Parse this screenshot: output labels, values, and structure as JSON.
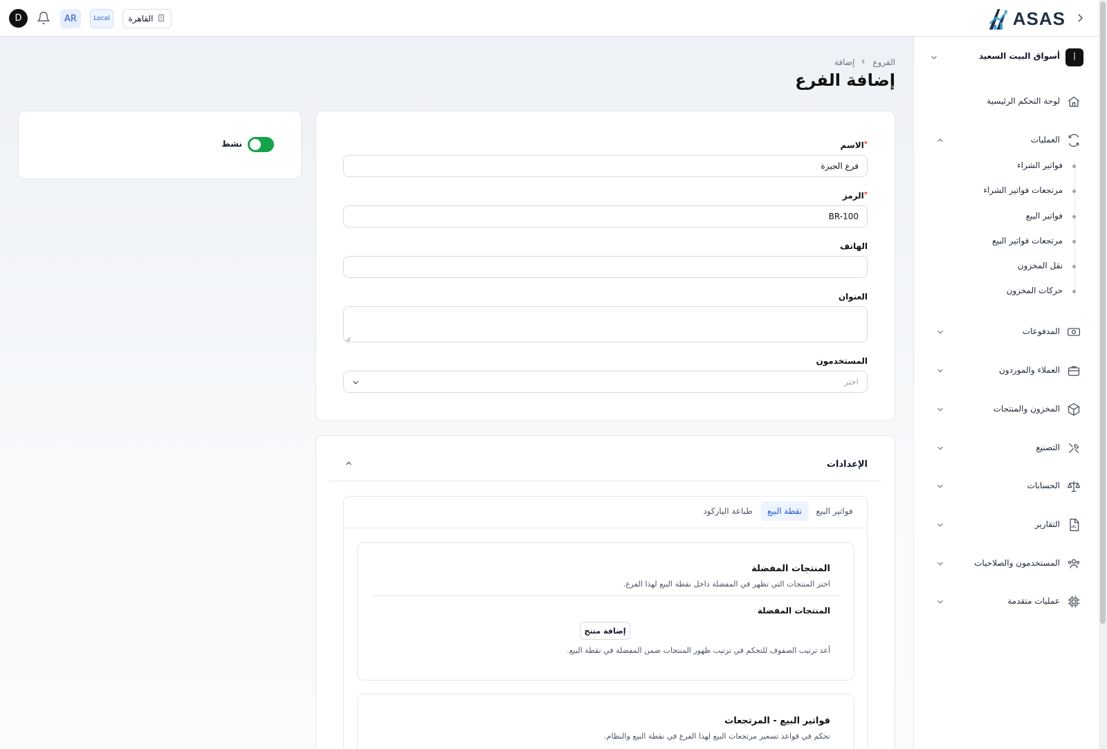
{
  "topbar": {
    "user_initial": "D",
    "language": "AR",
    "env_badge": "Local",
    "branch": "القاهرة",
    "logo_text": "ASAS"
  },
  "sidebar": {
    "org": {
      "badge": "أ",
      "name": "أسواق البيت السعيد"
    },
    "dashboard": "لوحة التحكم الرئيسية",
    "operations": {
      "label": "العمليات",
      "items": [
        "فواتير الشراء",
        "مرتجعات فواتير الشراء",
        "فواتير البيع",
        "مرتجعات فواتير البيع",
        "نقل المخزون",
        "حركات المخزون"
      ]
    },
    "sections": [
      "المدفوعات",
      "العملاء والموردون",
      "المخزون والمنتجات",
      "التصنيع",
      "الحسابات",
      "التقارير",
      "المستخدمون والصلاحيات",
      "عمليات متقدمة"
    ]
  },
  "breadcrumb": {
    "parent": "الفروع",
    "current": "إضافة"
  },
  "page_title": "إضافة الفرع",
  "form": {
    "name_label": "الاسم",
    "name_value": "فرع الجيزة",
    "code_label": "الرمز",
    "code_value": "BR-100",
    "phone_label": "الهاتف",
    "phone_value": "",
    "address_label": "العنوان",
    "users_label": "المستخدمون",
    "users_placeholder": "اختر",
    "required_mark": "*"
  },
  "status": {
    "active_label": "نشط",
    "active": true
  },
  "settings": {
    "title": "الإعدادات",
    "tabs": [
      "فواتير البيع",
      "نقطة البيع",
      "طباعة الباركود"
    ],
    "active_tab": "نقطة البيع",
    "favorites": {
      "title": "المنتجات المفضلة",
      "desc": "اختر المنتجات التي تظهر في المفضلة داخل نقطة البيع لهذا الفرع.",
      "subtitle": "المنتجات المفضلة",
      "add_button": "إضافة منتج",
      "hint": "أعد ترتيب الصفوف للتحكم في ترتيب ظهور المنتجات ضمن المفضلة في نقطة البيع."
    },
    "returns": {
      "title": "فواتير البيع - المرتجعات",
      "desc": "تحكم في قواعد تسعير مرتجعات البيع لهذا الفرع في نقطة البيع والنظام."
    }
  },
  "colors": {
    "accent": "#2158d3",
    "toggle_on": "#16a34a",
    "required": "#ef4444"
  }
}
